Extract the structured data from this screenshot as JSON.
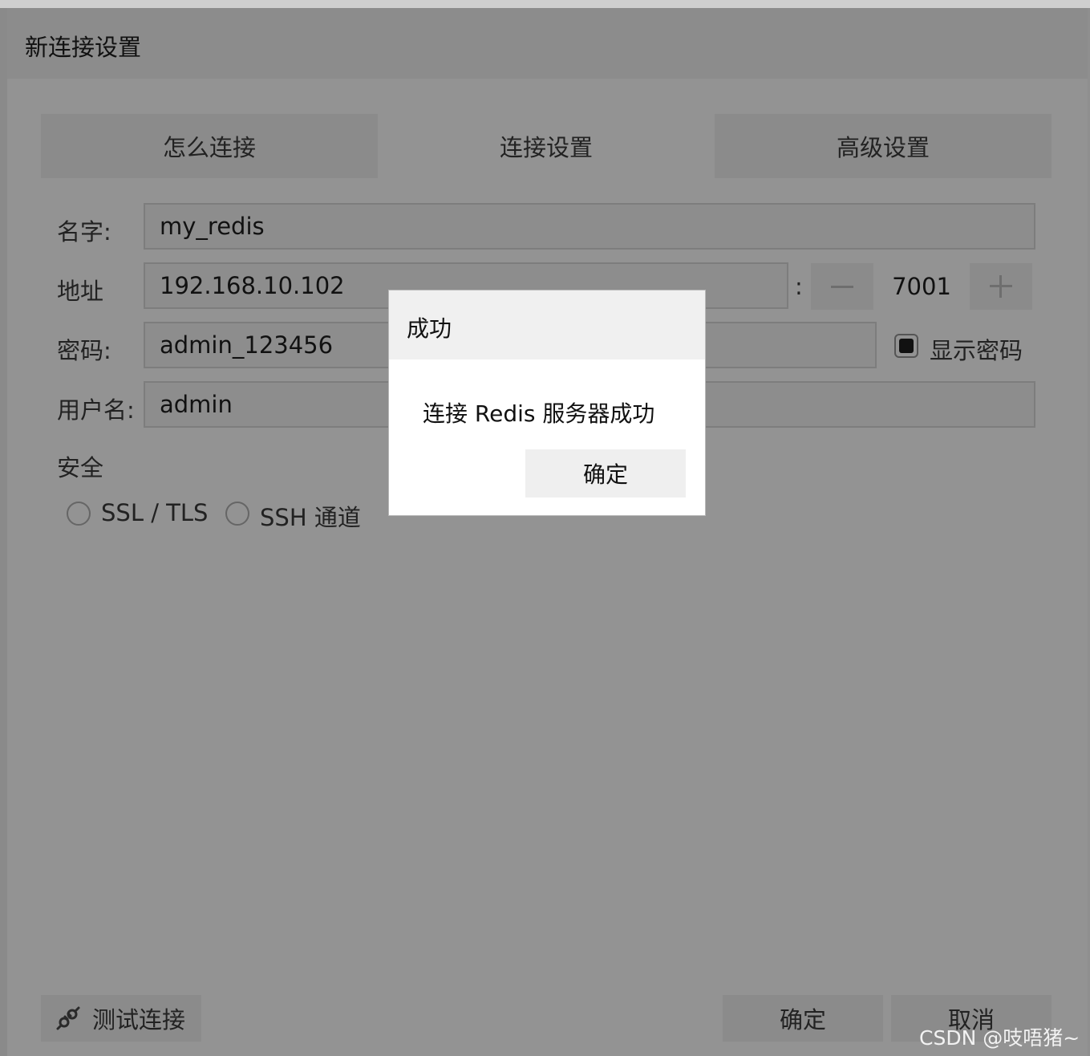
{
  "window": {
    "title": "新连接设置"
  },
  "tabs": [
    {
      "label": "怎么连接",
      "active": false
    },
    {
      "label": "连接设置",
      "active": true
    },
    {
      "label": "高级设置",
      "active": false
    }
  ],
  "form": {
    "name_label": "名字:",
    "name_value": "my_redis",
    "address_label": "地址",
    "address_value": "192.168.10.102",
    "port_sep": ":",
    "port_value": "7001",
    "password_label": "密码:",
    "password_value": "admin_123456",
    "show_password_label": "显示密码",
    "show_password_checked": true,
    "username_label": "用户名:",
    "username_value": "admin",
    "security_label": "安全",
    "ssl_label": "SSL / TLS",
    "ssh_label": "SSH 通道"
  },
  "footer": {
    "test_label": "测试连接",
    "ok_label": "确定",
    "cancel_label": "取消"
  },
  "dialog": {
    "title": "成功",
    "message": "连接 Redis 服务器成功",
    "ok_label": "确定"
  },
  "watermark": "CSDN @吱唔猪~",
  "icons": {
    "test": "plug-icon",
    "minus": "minus-icon",
    "plus": "plus-icon"
  }
}
